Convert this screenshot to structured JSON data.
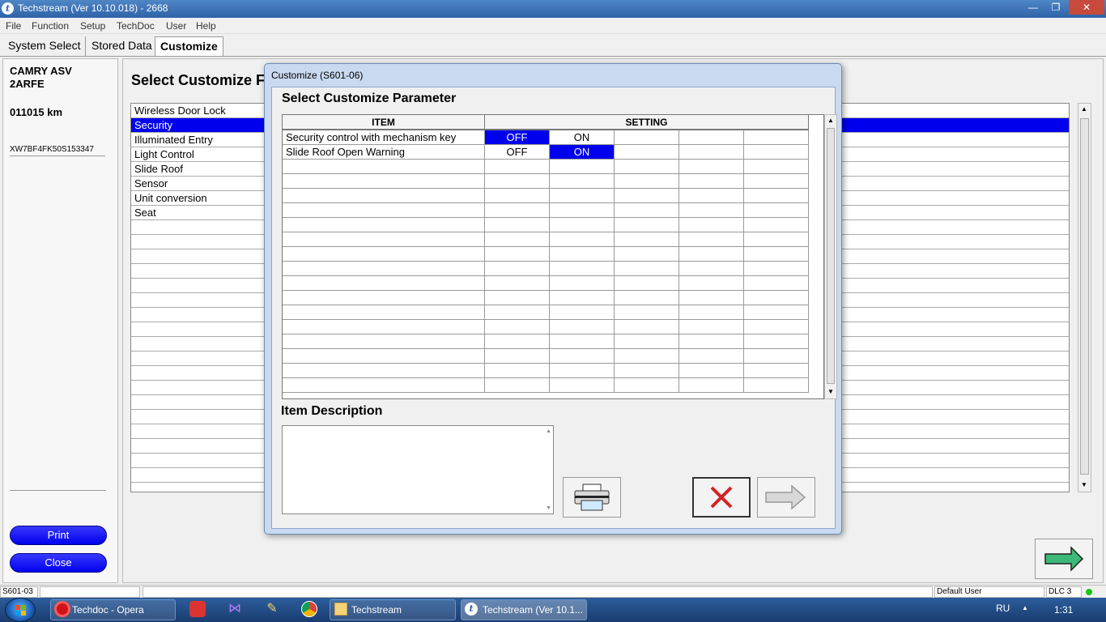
{
  "window": {
    "title": "Techstream (Ver 10.10.018) - 2668"
  },
  "menu": [
    "File",
    "Function",
    "Setup",
    "TechDoc",
    "User",
    "Help"
  ],
  "tabs": [
    {
      "label": "System Select",
      "active": false
    },
    {
      "label": "Stored Data",
      "active": false
    },
    {
      "label": "Customize",
      "active": true
    }
  ],
  "vehicle": {
    "model": "CAMRY ASV",
    "engine": "2ARFE",
    "odometer": "011015 km",
    "vin": "XW7BF4FK50S153347"
  },
  "left_buttons": {
    "print": "Print",
    "close": "Close"
  },
  "main": {
    "title": "Select Customize F",
    "list": [
      "Wireless Door Lock",
      "Security",
      "Illuminated Entry",
      "Light Control",
      "Slide Roof",
      "Sensor",
      "Unit conversion",
      "Seat"
    ],
    "selected_index": 1
  },
  "dialog": {
    "title": "Customize (S601-06)",
    "heading": "Select Customize Parameter",
    "columns": {
      "item": "ITEM",
      "setting": "SETTING"
    },
    "rows": [
      {
        "item": "Security control with mechanism key",
        "options": [
          "OFF",
          "ON"
        ],
        "selected": 0
      },
      {
        "item": "Slide Roof Open Warning",
        "options": [
          "OFF",
          "ON"
        ],
        "selected": 1
      }
    ],
    "description_label": "Item Description",
    "description_text": ""
  },
  "statusbar": {
    "code": "S601-03",
    "user": "Default User",
    "connection": "DLC 3"
  },
  "taskbar": {
    "items": [
      {
        "label": "Techdoc - Opera",
        "icon": "opera-icon"
      },
      {
        "label": "Techstream",
        "icon": "folder-icon"
      },
      {
        "label": "Techstream (Ver 10.1...",
        "icon": "techstream-icon"
      }
    ],
    "language": "RU",
    "time": "1:31"
  },
  "colors": {
    "selection": "#0000ee",
    "titlebar": "#2f63a8",
    "taskbar": "#1a3c70",
    "dialog_frame": "#c9daf0"
  }
}
